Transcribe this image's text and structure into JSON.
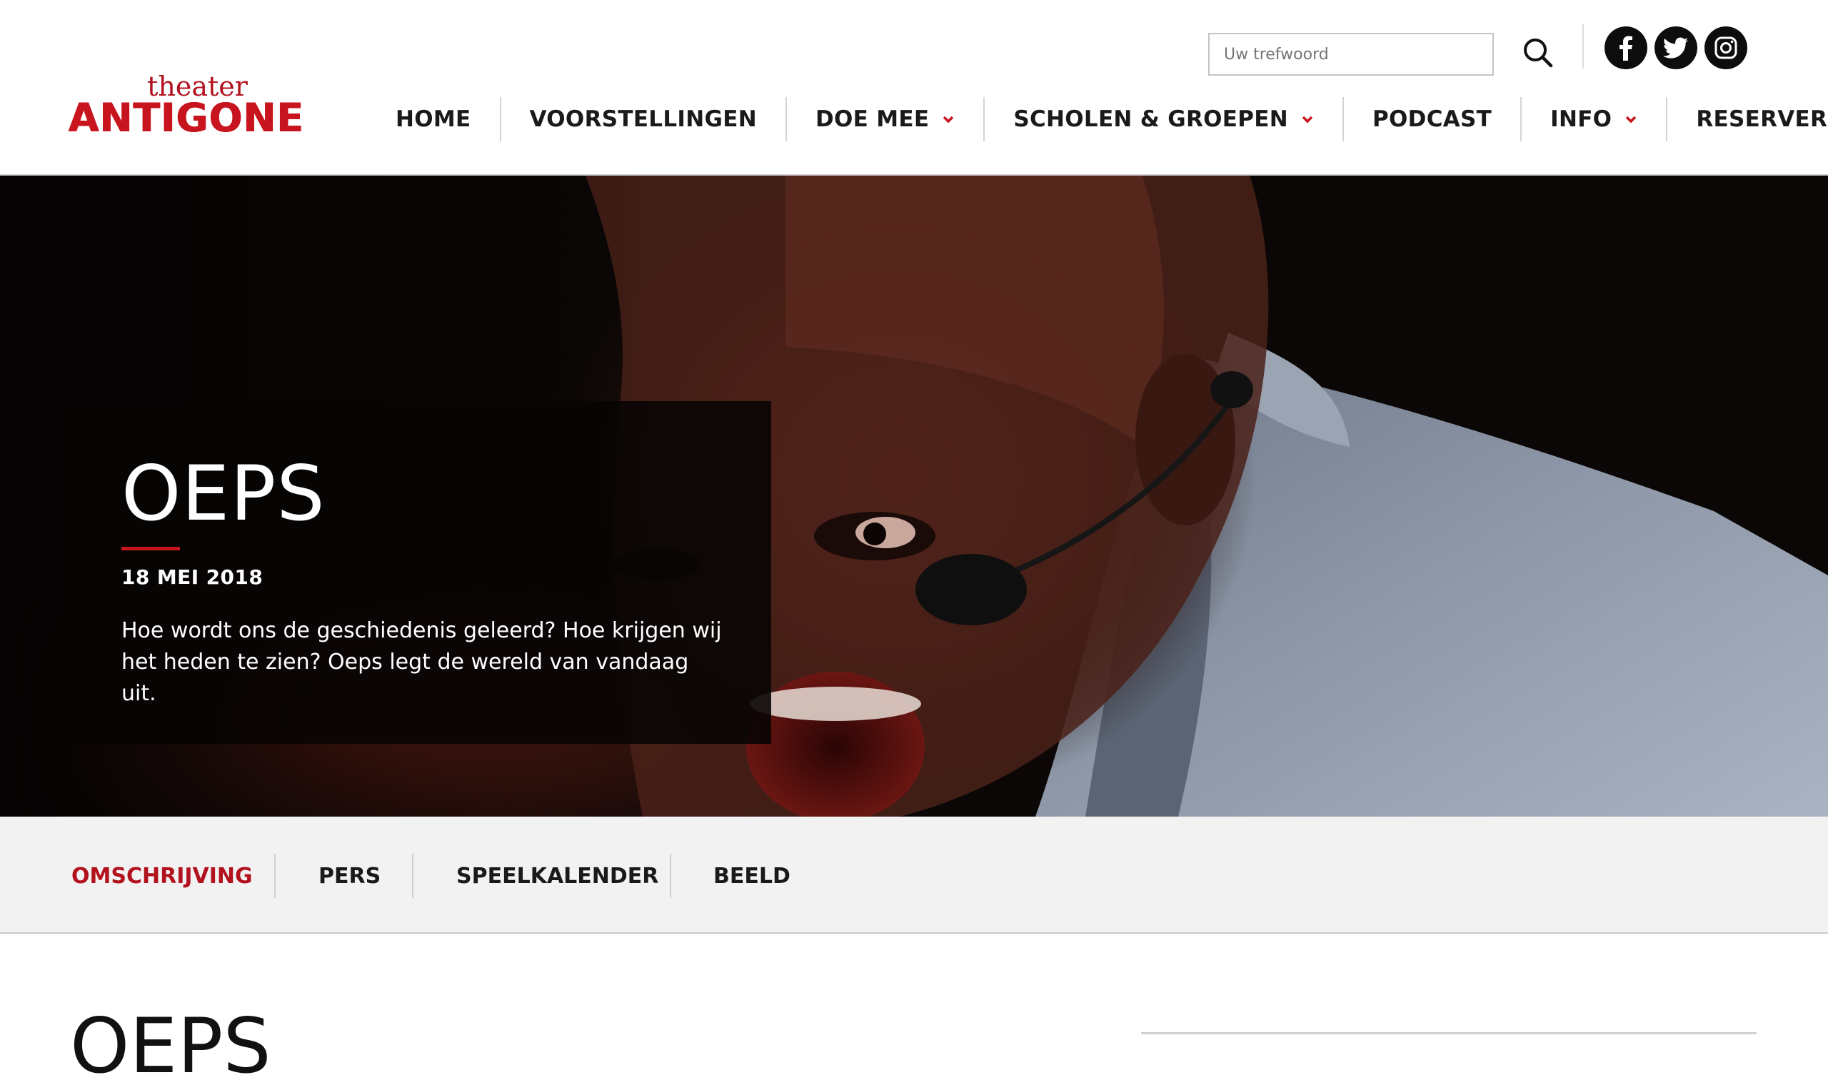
{
  "logo": {
    "small": "theater",
    "big": "ANTIGONE"
  },
  "search": {
    "placeholder": "Uw trefwoord"
  },
  "social": [
    {
      "icon": "facebook-icon"
    },
    {
      "icon": "twitter-icon"
    },
    {
      "icon": "instagram-icon"
    }
  ],
  "nav": {
    "items": [
      {
        "label": "HOME",
        "dropdown": false
      },
      {
        "label": "VOORSTELLINGEN",
        "dropdown": false
      },
      {
        "label": "DOE MEE",
        "dropdown": true
      },
      {
        "label": "SCHOLEN & GROEPEN",
        "dropdown": true
      },
      {
        "label": "PODCAST",
        "dropdown": false
      },
      {
        "label": "INFO",
        "dropdown": true
      },
      {
        "label": "RESERVEREN",
        "dropdown": false
      }
    ]
  },
  "hero": {
    "title": "OEPS",
    "date": "18 MEI 2018",
    "text": "Hoe wordt ons de geschiedenis geleerd? Hoe krijgen wij het heden te zien? Oeps legt de wereld van vandaag uit."
  },
  "tabs": {
    "items": [
      {
        "label": "OMSCHRIJVING",
        "active": true
      },
      {
        "label": "PERS",
        "active": false
      },
      {
        "label": "SPEELKALENDER",
        "active": false
      },
      {
        "label": "BEELD",
        "active": false
      }
    ]
  },
  "content": {
    "title": "OEPS"
  },
  "colors": {
    "brand_red": "#c8141f",
    "text_dark": "#1a1a1a",
    "tabs_bg": "#f2f2f2"
  }
}
